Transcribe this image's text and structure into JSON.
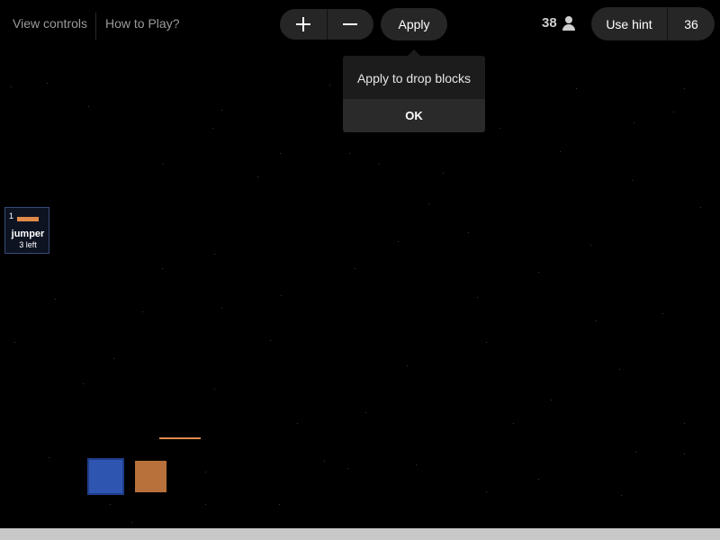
{
  "top_links": {
    "view_controls": "View controls",
    "how_to_play": "How to Play?"
  },
  "toolbar": {
    "zoom_in_icon": "plus-icon",
    "zoom_out_icon": "minus-icon",
    "apply_label": "Apply"
  },
  "tooltip": {
    "message": "Apply to drop blocks",
    "ok_label": "OK"
  },
  "players": {
    "count": "38",
    "icon": "user-icon"
  },
  "hint": {
    "label": "Use hint",
    "count": "36"
  },
  "palette": {
    "items": [
      {
        "index": "1",
        "name": "jumper",
        "remaining": "3 left",
        "color": "#e08a4a"
      }
    ]
  },
  "colors": {
    "background": "#000000",
    "pill": "#262626",
    "jumper": "#e08a4a",
    "blue_block": "#2e55b0",
    "orange_block": "#b8713a",
    "floor": "#c8c8c8"
  }
}
